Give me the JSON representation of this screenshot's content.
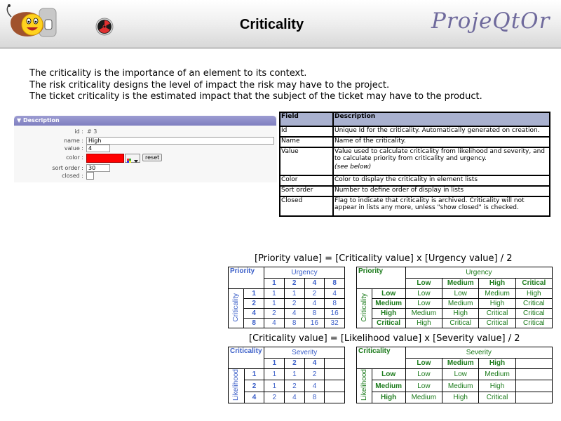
{
  "header": {
    "title": "Criticality",
    "brand": "ProjeQtOr"
  },
  "intro": [
    "The criticality is the importance  of an element to its context.",
    "The risk criticality designs the level of impact the risk may have to the project.",
    "The ticket criticality is the estimated impact that the subject of the ticket may have to the product."
  ],
  "panel": {
    "title": "Description",
    "id_label": "id :",
    "id_value": "# 3",
    "name_label": "name :",
    "name_value": "High",
    "value_label": "value :",
    "value_value": "4",
    "color_label": "color :",
    "color_value": "#ff0000",
    "reset_label": "reset",
    "sort_label": "sort order :",
    "sort_value": "30",
    "closed_label": "closed :"
  },
  "field_table": {
    "headers": [
      "Field",
      "Description"
    ],
    "rows": [
      [
        "Id",
        "Unique Id for the criticality. Automatically generated on creation."
      ],
      [
        "Name",
        "Name of the criticality."
      ],
      [
        "Value",
        "Value used to calculate criticality from likelihood and severity, and to calculate priority from criticality and urgency."
      ],
      [
        "Color",
        "Color to display the criticality in element lists"
      ],
      [
        "Sort order",
        "Number to define order of display in lists"
      ],
      [
        "Closed",
        "Flag to indicate that criticality is archived. Criticality will not appear in lists any more, unless \"show closed\" is checked."
      ]
    ],
    "value_note": "(see below)"
  },
  "formula_priority": "[Priority value] = [Criticality value] x [Urgency value] / 2",
  "formula_criticality": "[Criticality value] = [Likelihood value] x [Severity value] / 2",
  "priority_num": {
    "corner": "Priority",
    "col_title": "Urgency",
    "row_title": "Criticality",
    "cols": [
      "1",
      "2",
      "4",
      "8"
    ],
    "rows": [
      {
        "h": "1",
        "v": [
          "1",
          "1",
          "2",
          "4"
        ]
      },
      {
        "h": "2",
        "v": [
          "1",
          "2",
          "4",
          "8"
        ]
      },
      {
        "h": "4",
        "v": [
          "2",
          "4",
          "8",
          "16"
        ]
      },
      {
        "h": "8",
        "v": [
          "4",
          "8",
          "16",
          "32"
        ]
      }
    ]
  },
  "priority_txt": {
    "corner": "Priority",
    "col_title": "Urgency",
    "row_title": "Criticality",
    "cols": [
      "Low",
      "Medium",
      "High",
      "Critical"
    ],
    "rows": [
      {
        "h": "Low",
        "v": [
          "Low",
          "Low",
          "Medium",
          "High"
        ]
      },
      {
        "h": "Medium",
        "v": [
          "Low",
          "Medium",
          "High",
          "Critical"
        ]
      },
      {
        "h": "High",
        "v": [
          "Medium",
          "High",
          "Critical",
          "Critical"
        ]
      },
      {
        "h": "Critical",
        "v": [
          "High",
          "Critical",
          "Critical",
          "Critical"
        ]
      }
    ]
  },
  "crit_num": {
    "corner": "Criticality",
    "col_title": "Severity",
    "row_title": "Likelihood",
    "cols": [
      "1",
      "2",
      "4",
      ""
    ],
    "rows": [
      {
        "h": "1",
        "v": [
          "1",
          "1",
          "2",
          ""
        ]
      },
      {
        "h": "2",
        "v": [
          "1",
          "2",
          "4",
          ""
        ]
      },
      {
        "h": "4",
        "v": [
          "2",
          "4",
          "8",
          ""
        ]
      }
    ]
  },
  "crit_txt": {
    "corner": "Criticality",
    "col_title": "Severity",
    "row_title": "Likelihood",
    "cols": [
      "Low",
      "Medium",
      "High",
      ""
    ],
    "rows": [
      {
        "h": "Low",
        "v": [
          "Low",
          "Low",
          "Medium",
          ""
        ]
      },
      {
        "h": "Medium",
        "v": [
          "Low",
          "Medium",
          "High",
          ""
        ]
      },
      {
        "h": "High",
        "v": [
          "Medium",
          "High",
          "Critical",
          ""
        ]
      }
    ]
  }
}
